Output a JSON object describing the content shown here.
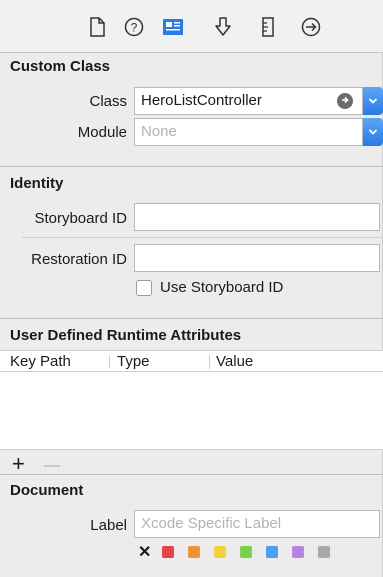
{
  "toolbar": {
    "icons": [
      "file-icon",
      "help-icon",
      "identity-icon",
      "attributes-icon",
      "size-icon",
      "connections-icon"
    ],
    "selected": "identity-icon",
    "accent": "#2a7ae4"
  },
  "custom_class": {
    "title": "Custom Class",
    "class_label": "Class",
    "class_value": "HeroListController",
    "module_label": "Module",
    "module_placeholder": "None"
  },
  "identity": {
    "title": "Identity",
    "storyboard_id_label": "Storyboard ID",
    "storyboard_id_value": "",
    "restoration_id_label": "Restoration ID",
    "restoration_id_value": "",
    "use_storyboard_id_label": "Use Storyboard ID",
    "use_storyboard_id_checked": false
  },
  "runtime_attributes": {
    "title": "User Defined Runtime Attributes",
    "columns": [
      "Key Path",
      "Type",
      "Value"
    ],
    "rows": [],
    "add_label": "+",
    "remove_label": "—"
  },
  "document": {
    "title": "Document",
    "label_label": "Label",
    "label_placeholder": "Xcode Specific Label",
    "clear_label": "✕",
    "colors": [
      "#e8474a",
      "#f0913a",
      "#f2d13f",
      "#7ccf4c",
      "#4d9ef3",
      "#b583e0",
      "#a8a8a8"
    ]
  }
}
